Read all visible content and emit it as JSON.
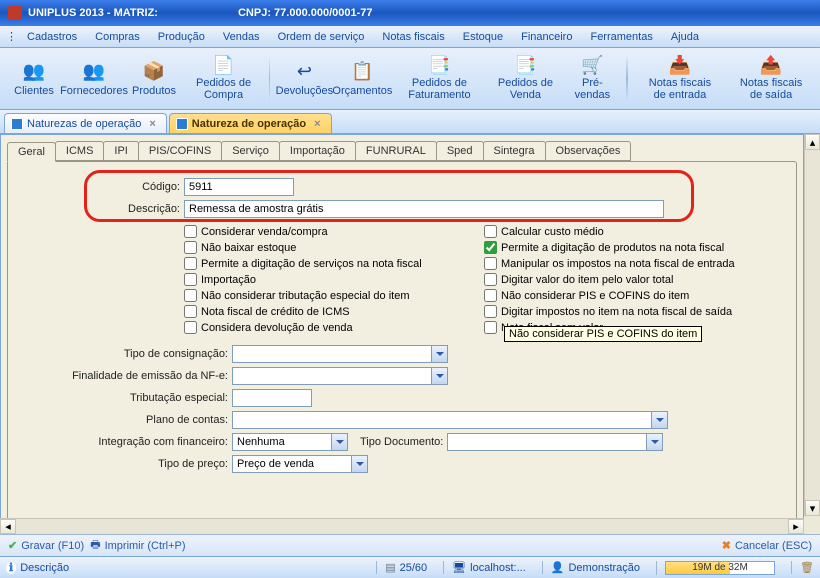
{
  "app": {
    "title": "UNIPLUS  2013 - MATRIZ:",
    "cnpj_label": "CNPJ: 77.000.000/0001-77"
  },
  "menu": {
    "items": [
      "Cadastros",
      "Compras",
      "Produção",
      "Vendas",
      "Ordem de serviço",
      "Notas fiscais",
      "Estoque",
      "Financeiro",
      "Ferramentas",
      "Ajuda"
    ]
  },
  "toolbar": {
    "items": [
      "Clientes",
      "Fornecedores",
      "Produtos",
      "Pedidos de Compra",
      "Devoluções",
      "Orçamentos",
      "Pedidos de Faturamento",
      "Pedidos de Venda",
      "Pré-vendas",
      "Notas fiscais de entrada",
      "Notas fiscais de saída"
    ]
  },
  "doc_tabs": {
    "items": [
      {
        "label": "Naturezas de operação",
        "active": false
      },
      {
        "label": "Natureza de operação",
        "active": true
      }
    ]
  },
  "inner_tabs": {
    "items": [
      "Geral",
      "ICMS",
      "IPI",
      "PIS/COFINS",
      "Serviço",
      "Importação",
      "FUNRURAL",
      "Sped",
      "Sintegra",
      "Observações"
    ],
    "active": "Geral"
  },
  "form": {
    "codigo_label": "Código:",
    "codigo_value": "5911",
    "descricao_label": "Descrição:",
    "descricao_value": "Remessa de amostra grátis",
    "tipo_consignacao_label": "Tipo de consignação:",
    "finalidade_label": "Finalidade de emissão da NF-e:",
    "tributacao_label": "Tributação especial:",
    "plano_contas_label": "Plano de contas:",
    "integracao_label": "Integração com financeiro:",
    "integracao_value": "Nenhuma",
    "tipo_doc_label": "Tipo Documento:",
    "tipo_preco_label": "Tipo de preço:",
    "tipo_preco_value": "Preço de venda"
  },
  "checks": {
    "left": [
      "Considerar venda/compra",
      "Não baixar estoque",
      "Permite a digitação de serviços na nota fiscal",
      "Importação",
      "Não considerar tributação especial do item",
      "Nota fiscal de crédito de ICMS",
      "Considera devolução de venda"
    ],
    "right": [
      "Calcular custo médio",
      "Permite a digitação de produtos na nota fiscal",
      "Manipular os impostos na nota fiscal de entrada",
      "Digitar valor do item pelo valor total",
      "Não considerar PIS e COFINS do item",
      "Digitar impostos no item na nota fiscal de saída",
      "Nota fiscal sem valor"
    ],
    "right_checked_index": 1,
    "right_orange_index": 4
  },
  "tooltip": "Não considerar PIS e COFINS do item",
  "footer": {
    "save": "Gravar (F10)",
    "print": "Imprimir (Ctrl+P)",
    "cancel": "Cancelar (ESC)"
  },
  "status": {
    "desc": "Descrição",
    "pos": "25/60",
    "server": "localhost:...",
    "user": "Demonstração",
    "mem": "19M de 32M"
  }
}
